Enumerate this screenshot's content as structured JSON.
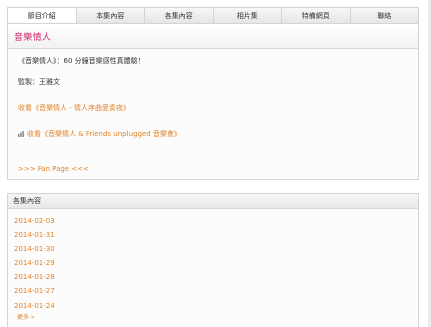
{
  "tabs": [
    "節目介紹",
    "本集內容",
    "各集內容",
    "相片集",
    "特備網頁",
    "聯絡"
  ],
  "active_tab": 0,
  "program": {
    "title": "音樂情人",
    "description": "《音樂情人》：60 分鐘音樂感性真體驗！",
    "producer": "監製：王雅文",
    "link1": "收看《音樂情人 - 情人序曲愛奏夜》",
    "link2": "收看《音樂情人 & Friends unplugged 音樂會》",
    "link2_icon": "music-icon",
    "fan_page": ">>> Fan Page <<<"
  },
  "episodes": {
    "header": "各集內容",
    "dates": [
      "2014-02-03",
      "2014-01-31",
      "2014-01-30",
      "2014-01-29",
      "2014-01-28",
      "2014-01-27",
      "2014-01-24"
    ],
    "more": "更多 »"
  },
  "colors": {
    "title": "#d1226b",
    "link": "#e0832a",
    "border": "#d4d4d4"
  }
}
